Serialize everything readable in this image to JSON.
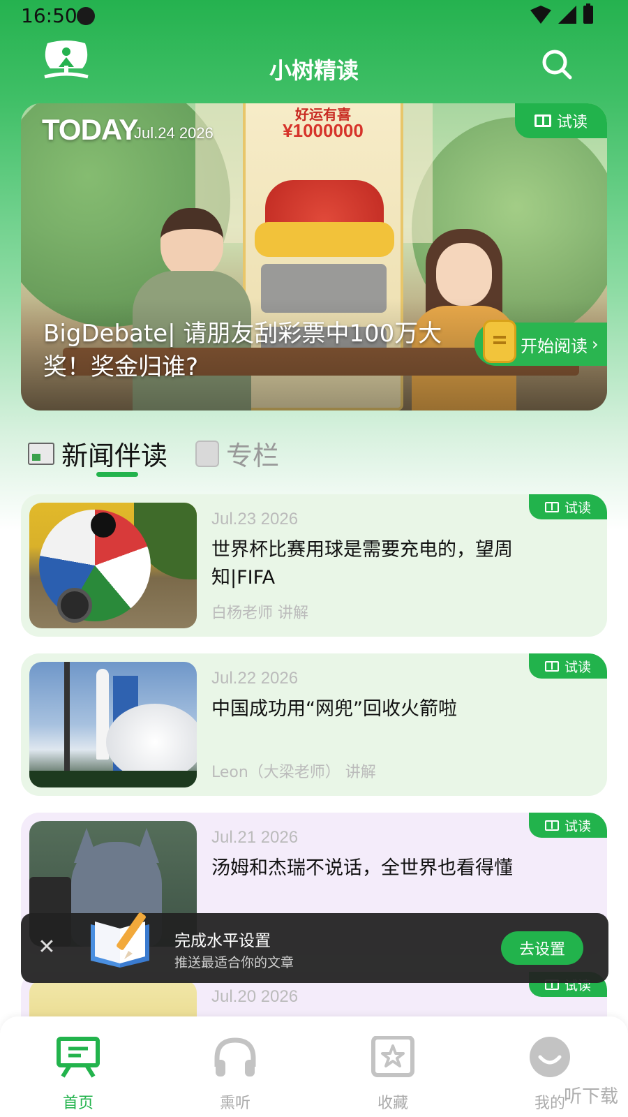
{
  "status_bar": {
    "time": "16:50"
  },
  "header": {
    "title": "小树精读"
  },
  "hero": {
    "today": "TODAY",
    "date": "Jul.24 2026",
    "trial_label": "试读",
    "title": "BigDebate| 请朋友刮彩票中100万大奖！奖金归谁?",
    "start_label": "开始阅读",
    "ticket_top": "好运有喜",
    "ticket_amount": "¥1000000"
  },
  "tabs": [
    {
      "label": "新闻伴读",
      "active": true
    },
    {
      "label": "专栏",
      "active": false
    }
  ],
  "articles": [
    {
      "date": "Jul.23 2026",
      "title": "世界杯比赛用球是需要充电的，望周知|FIFA",
      "author": "白杨老师 讲解",
      "trial": "试读"
    },
    {
      "date": "Jul.22 2026",
      "title": "中国成功用“网兜”回收火箭啦",
      "author": "Leon（大梁老师） 讲解",
      "trial": "试读"
    },
    {
      "date": "Jul.21 2026",
      "title": "汤姆和杰瑞不说话，全世界也看得懂",
      "author": "",
      "trial": "试读"
    },
    {
      "date": "Jul.20 2026",
      "title": "",
      "author": "",
      "trial": "试读"
    }
  ],
  "toast": {
    "title": "完成水平设置",
    "subtitle": "推送最适合你的文章",
    "button": "去设置",
    "close_icon": "close-icon"
  },
  "bottom_nav": [
    {
      "label": "首页",
      "icon": "home-board-icon",
      "active": true
    },
    {
      "label": "熏听",
      "icon": "headphones-icon",
      "active": false
    },
    {
      "label": "收藏",
      "icon": "star-box-icon",
      "active": false
    },
    {
      "label": "我的",
      "icon": "smile-face-icon",
      "active": false
    }
  ],
  "watermark": "听下载",
  "colors": {
    "brand_green": "#22b34c",
    "card_green_bg": "#e9f6e7",
    "card_purple_bg": "#f4ecfa",
    "toast_bg": "#222222"
  }
}
